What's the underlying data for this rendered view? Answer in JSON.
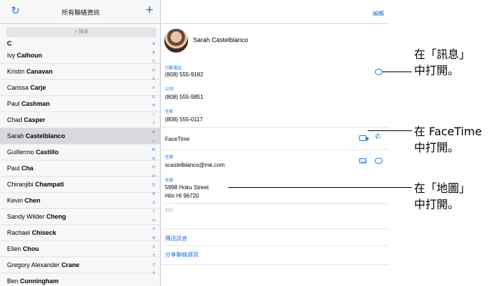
{
  "left_pane": {
    "title": "所有聯絡資訊",
    "search_placeholder": "搜尋",
    "section_letter": "C",
    "contacts": [
      {
        "first": "Ivy",
        "last": "Calhoun"
      },
      {
        "first": "Kristin",
        "last": "Canavan"
      },
      {
        "first": "Carissa",
        "last": "Carje"
      },
      {
        "first": "Paul",
        "last": "Cashman"
      },
      {
        "first": "Chad",
        "last": "Casper"
      },
      {
        "first": "Sarah",
        "last": "Castelblanco",
        "selected": true
      },
      {
        "first": "Guillermo",
        "last": "Castillo"
      },
      {
        "first": "Paul",
        "last": "Cha"
      },
      {
        "first": "Chiranjibi",
        "last": "Champati"
      },
      {
        "first": "Kevin",
        "last": "Chen"
      },
      {
        "first": "Sandy Wilder",
        "last": "Cheng"
      },
      {
        "first": "Rachael",
        "last": "Chiseck"
      },
      {
        "first": "Ellen",
        "last": "Chou"
      },
      {
        "first": "Gregory Alexander",
        "last": "Crane"
      },
      {
        "first": "Ben",
        "last": "Cunningham"
      }
    ],
    "index_letters": [
      "A",
      "B",
      "C",
      "D",
      "E",
      "F",
      "G",
      "H",
      "I",
      "J",
      "K",
      "L",
      "M",
      "N",
      "O",
      "P",
      "Q",
      "R",
      "S",
      "T",
      "U",
      "V",
      "W",
      "X",
      "Y",
      "Z",
      "#"
    ]
  },
  "detail": {
    "edit_label": "編輯",
    "name": "Sarah Castelblanco",
    "phones": [
      {
        "label": "行動電話",
        "value": "(808) 555-9182"
      },
      {
        "label": "公司",
        "value": "(808) 555-9851"
      },
      {
        "label": "住家",
        "value": "(808) 555-0117"
      }
    ],
    "facetime_label": "FaceTime",
    "email": {
      "label": "住家",
      "value": "scastelblanco@me.com"
    },
    "address": {
      "label": "住家",
      "line1": "5998 Hoku Street",
      "line2": "Hilo HI 96720"
    },
    "notes_label": "附註",
    "send_message": "傳送訊息",
    "share_contact": "分享聯絡資訊"
  },
  "callouts": {
    "messages": {
      "line1": "在「訊息」",
      "line2": "中打開。"
    },
    "facetime": {
      "line1": "在 FaceTime",
      "line2": "中打開。"
    },
    "maps": {
      "line1": "在「地圖」",
      "line2": "中打開。"
    }
  },
  "colors": {
    "accent": "#1a73e8",
    "selected_row": "#d9d9dd"
  },
  "icons": [
    "refresh-icon",
    "add-icon",
    "search-icon",
    "message-icon",
    "video-icon",
    "phone-icon",
    "mail-icon"
  ]
}
